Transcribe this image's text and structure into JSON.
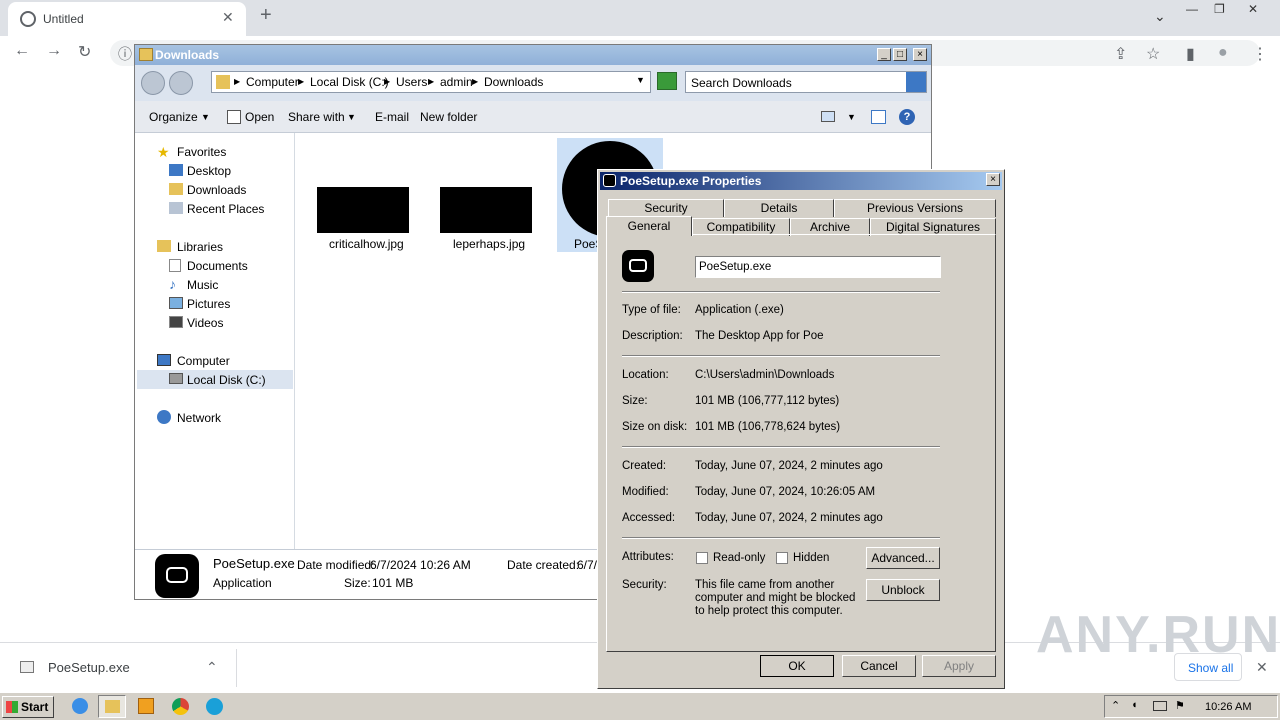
{
  "browser": {
    "tab_title": "Untitled",
    "close_glyph": "✕",
    "newtab_glyph": "+",
    "nav": {
      "back": "←",
      "forward": "→",
      "reload": "↻",
      "info": "ⓘ"
    },
    "toolbar": {
      "share": "⇪",
      "star": "☆",
      "sidebar": "▮",
      "profile": "●",
      "menu": "⋮"
    },
    "window_controls": {
      "chevron": "⌄",
      "min": "—",
      "max": "❐",
      "close": "✕"
    }
  },
  "download_bar": {
    "file": "PoeSetup.exe",
    "show_all": "Show all",
    "chevron": "⌃",
    "close": "✕"
  },
  "explorer": {
    "title": "Downloads",
    "breadcrumb": [
      "Computer",
      "Local Disk (C:)",
      "Users",
      "admin",
      "Downloads"
    ],
    "search_placeholder": "Search Downloads",
    "commands": {
      "organize": "Organize",
      "open": "Open",
      "share_with": "Share with",
      "email": "E-mail",
      "new_folder": "New folder"
    },
    "nav": {
      "favorites": "Favorites",
      "desktop": "Desktop",
      "downloads": "Downloads",
      "recent": "Recent Places",
      "libraries": "Libraries",
      "documents": "Documents",
      "music": "Music",
      "pictures": "Pictures",
      "videos": "Videos",
      "computer": "Computer",
      "local_disk": "Local Disk (C:)",
      "network": "Network"
    },
    "files": [
      "criticalhow.jpg",
      "leperhaps.jpg",
      "PoeS"
    ],
    "details": {
      "name": "PoeSetup.exe",
      "type": "Application",
      "modified_label": "Date modified:",
      "modified": "6/7/2024 10:26 AM",
      "size_label": "Size:",
      "size": "101 MB",
      "created_label": "Date created:",
      "created": "6/7/"
    }
  },
  "properties": {
    "title": "PoeSetup.exe Properties",
    "tabs_back": [
      "Security",
      "Details",
      "Previous Versions"
    ],
    "tabs_front": [
      "General",
      "Compatibility",
      "Archive",
      "Digital Signatures"
    ],
    "filename": "PoeSetup.exe",
    "rows": {
      "type_label": "Type of file:",
      "type": "Application (.exe)",
      "desc_label": "Description:",
      "desc": "The Desktop App for Poe",
      "loc_label": "Location:",
      "loc": "C:\\Users\\admin\\Downloads",
      "size_label": "Size:",
      "size": "101 MB (106,777,112 bytes)",
      "disk_label": "Size on disk:",
      "disk": "101 MB (106,778,624 bytes)",
      "created_label": "Created:",
      "created": "Today, June 07, 2024, 2 minutes ago",
      "modified_label": "Modified:",
      "modified": "Today, June 07, 2024, 10:26:05 AM",
      "accessed_label": "Accessed:",
      "accessed": "Today, June 07, 2024, 2 minutes ago",
      "attr_label": "Attributes:",
      "readonly": "Read-only",
      "hidden": "Hidden",
      "advanced": "Advanced...",
      "sec_label": "Security:",
      "sec_text": "This file came from another computer and might be blocked to help protect this computer.",
      "unblock": "Unblock"
    },
    "buttons": {
      "ok": "OK",
      "cancel": "Cancel",
      "apply": "Apply"
    }
  },
  "taskbar": {
    "start": "Start",
    "time": "10:26 AM"
  },
  "watermark": "ANY.RUN"
}
